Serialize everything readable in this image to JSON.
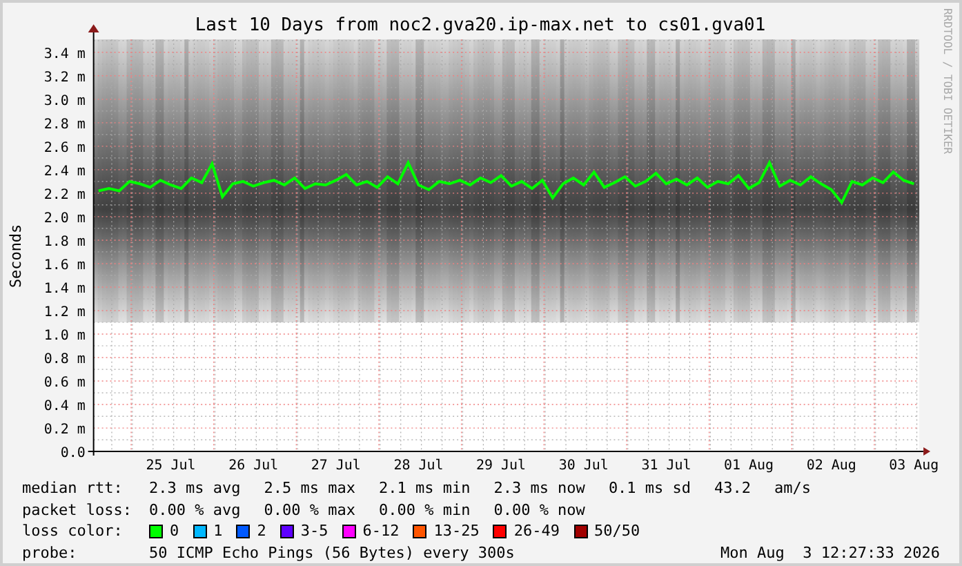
{
  "credit": "RRDTOOL / TOBI OETIKER",
  "chart": {
    "chart_data": {
      "type": "line",
      "title": "Last 10 Days from noc2.gva20.ip-max.net to cs01.gva01",
      "ylabel": "Seconds",
      "grid": true,
      "ylim": [
        0,
        3.51
      ],
      "yticks": [
        {
          "value": 0,
          "label": "0.0"
        },
        {
          "value": 0.2,
          "label": "0.2 m"
        },
        {
          "value": 0.4,
          "label": "0.4 m"
        },
        {
          "value": 0.6,
          "label": "0.6 m"
        },
        {
          "value": 0.8,
          "label": "0.8 m"
        },
        {
          "value": 1.0,
          "label": "1.0 m"
        },
        {
          "value": 1.2,
          "label": "1.2 m"
        },
        {
          "value": 1.4,
          "label": "1.4 m"
        },
        {
          "value": 1.6,
          "label": "1.6 m"
        },
        {
          "value": 1.8,
          "label": "1.8 m"
        },
        {
          "value": 2.0,
          "label": "2.0 m"
        },
        {
          "value": 2.2,
          "label": "2.2 m"
        },
        {
          "value": 2.4,
          "label": "2.4 m"
        },
        {
          "value": 2.6,
          "label": "2.6 m"
        },
        {
          "value": 2.8,
          "label": "2.8 m"
        },
        {
          "value": 3.0,
          "label": "3.0 m"
        },
        {
          "value": 3.2,
          "label": "3.2 m"
        },
        {
          "value": 3.4,
          "label": "3.4 m"
        }
      ],
      "categories": [
        null,
        null,
        null,
        null,
        null,
        null,
        null,
        "25 Jul",
        null,
        null,
        null,
        null,
        null,
        null,
        null,
        "26 Jul",
        null,
        null,
        null,
        null,
        null,
        null,
        null,
        "27 Jul",
        null,
        null,
        null,
        null,
        null,
        null,
        null,
        "28 Jul",
        null,
        null,
        null,
        null,
        null,
        null,
        null,
        "29 Jul",
        null,
        null,
        null,
        null,
        null,
        null,
        null,
        "30 Jul",
        null,
        null,
        null,
        null,
        null,
        null,
        null,
        "31 Jul",
        null,
        null,
        null,
        null,
        null,
        null,
        null,
        "01 Aug",
        null,
        null,
        null,
        null,
        null,
        null,
        null,
        "02 Aug",
        null,
        null,
        null,
        null,
        null,
        null,
        null,
        "03 Aug"
      ],
      "series": [
        {
          "color": "#00ff00",
          "values": [
            2.22,
            2.24,
            2.22,
            2.3,
            2.28,
            2.25,
            2.31,
            2.27,
            2.24,
            2.33,
            2.29,
            2.45,
            2.17,
            2.28,
            2.3,
            2.26,
            2.29,
            2.31,
            2.27,
            2.33,
            2.24,
            2.28,
            2.27,
            2.31,
            2.36,
            2.27,
            2.3,
            2.25,
            2.34,
            2.28,
            2.46,
            2.27,
            2.23,
            2.3,
            2.28,
            2.31,
            2.27,
            2.33,
            2.29,
            2.35,
            2.26,
            2.3,
            2.24,
            2.31,
            2.16,
            2.28,
            2.33,
            2.27,
            2.38,
            2.25,
            2.29,
            2.34,
            2.26,
            2.3,
            2.37,
            2.28,
            2.32,
            2.27,
            2.33,
            2.25,
            2.3,
            2.28,
            2.35,
            2.24,
            2.29,
            2.46,
            2.26,
            2.31,
            2.27,
            2.34,
            2.28,
            2.23,
            2.12,
            2.3,
            2.27,
            2.33,
            2.29,
            2.38,
            2.31,
            2.28
          ]
        }
      ]
    }
  },
  "legend": {
    "median_rtt": {
      "label": "median rtt:",
      "values": [
        "2.3 ms avg",
        "2.5 ms max",
        "2.1 ms min",
        "2.3 ms now",
        "0.1 ms sd",
        "43.2",
        "am/s"
      ]
    },
    "packet_loss": {
      "label": "packet loss:",
      "values": [
        "0.00 % avg",
        "0.00 % max",
        "0.00 % min",
        "0.00 % now"
      ]
    },
    "loss_color": {
      "label": "loss color:",
      "items": [
        {
          "label": "0",
          "color": "#00ff00"
        },
        {
          "label": "1",
          "color": "#00b8ff"
        },
        {
          "label": "2",
          "color": "#0059ff"
        },
        {
          "label": "3-5",
          "color": "#5e00ff"
        },
        {
          "label": "6-12",
          "color": "#ff00ff"
        },
        {
          "label": "13-25",
          "color": "#ff5500"
        },
        {
          "label": "26-49",
          "color": "#ff0000"
        },
        {
          "label": "50/50",
          "color": "#a10000"
        }
      ]
    },
    "probe": {
      "label": "probe:",
      "text": "50 ICMP Echo Pings (56 Bytes) every 300s",
      "timestamp": "Mon Aug  3 12:27:33 2026"
    }
  }
}
